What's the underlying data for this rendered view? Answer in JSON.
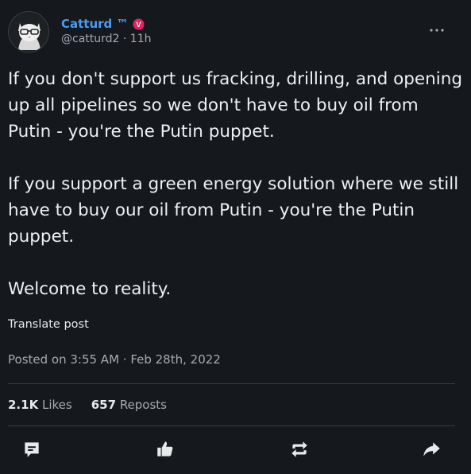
{
  "author": {
    "display_name": "Catturd ™",
    "handle": "@catturd2",
    "time_ago": "11h",
    "separator": "·",
    "badge_letter": "V"
  },
  "tweet": {
    "text": "If you don't support us fracking, drilling, and opening up all pipelines so we don't have to buy oil from Putin - you're the Putin puppet.\n\nIf you support a green energy solution where we still have to buy our oil from Putin - you're the Putin puppet.\n\nWelcome to reality.",
    "translate_label": "Translate post",
    "posted_on": "Posted on 3:55 AM · Feb 28th, 2022"
  },
  "stats": {
    "likes_count": "2.1K",
    "likes_label": "Likes",
    "reposts_count": "657",
    "reposts_label": "Reposts"
  },
  "actions": [
    "comment-icon",
    "like-icon",
    "repost-icon",
    "share-icon"
  ],
  "colors": {
    "background": "#15181c",
    "accent": "#4c9bf0",
    "badge": "#e0245e",
    "text": "#e7e9ea",
    "muted": "#a7abb0"
  }
}
